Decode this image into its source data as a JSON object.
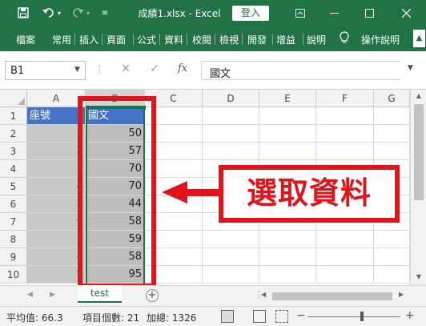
{
  "titlebar": {
    "title": "成績1.xlsx  -  Excel",
    "login_label": "登入",
    "icons": [
      "save-icon",
      "undo-icon",
      "redo-icon",
      "customize-qat-icon",
      "ribbon-display-icon",
      "minimize-icon",
      "maximize-icon",
      "close-icon"
    ],
    "bg_color": "#217346"
  },
  "ribbon": {
    "tabs": [
      "檔案",
      "常用",
      "插入",
      "頁面",
      "公式",
      "資料",
      "校閱",
      "檢視",
      "開發",
      "增益",
      "說明"
    ],
    "tell_me": "操作說明",
    "scroll_glyph": "▲"
  },
  "formula_bar": {
    "name_box": "B1",
    "cancel_glyph": "✕",
    "enter_glyph": "✓",
    "fx_label": "fx",
    "value": "國文"
  },
  "grid": {
    "columns": [
      "A",
      "B",
      "C",
      "D",
      "E",
      "F",
      "G"
    ],
    "selected_column": "B",
    "rows": [
      "1",
      "2",
      "3",
      "4",
      "5",
      "6",
      "7",
      "8",
      "9",
      "10"
    ],
    "col_a": [
      "座號",
      "1",
      "2",
      "3",
      "4",
      "5",
      "6",
      "7",
      "8",
      "9"
    ],
    "col_b": [
      "國文",
      "50",
      "57",
      "70",
      "70",
      "44",
      "58",
      "59",
      "58",
      "95"
    ]
  },
  "annotation": {
    "callout_text": "選取資料",
    "color": "#e0151b"
  },
  "sheets": {
    "active": "test",
    "add_glyph": "+"
  },
  "status": {
    "average": "平均值: 66.3",
    "count": "項目個數: 21",
    "sum": "加總: 1326",
    "zoom_minus": "−",
    "zoom_plus": "+"
  }
}
